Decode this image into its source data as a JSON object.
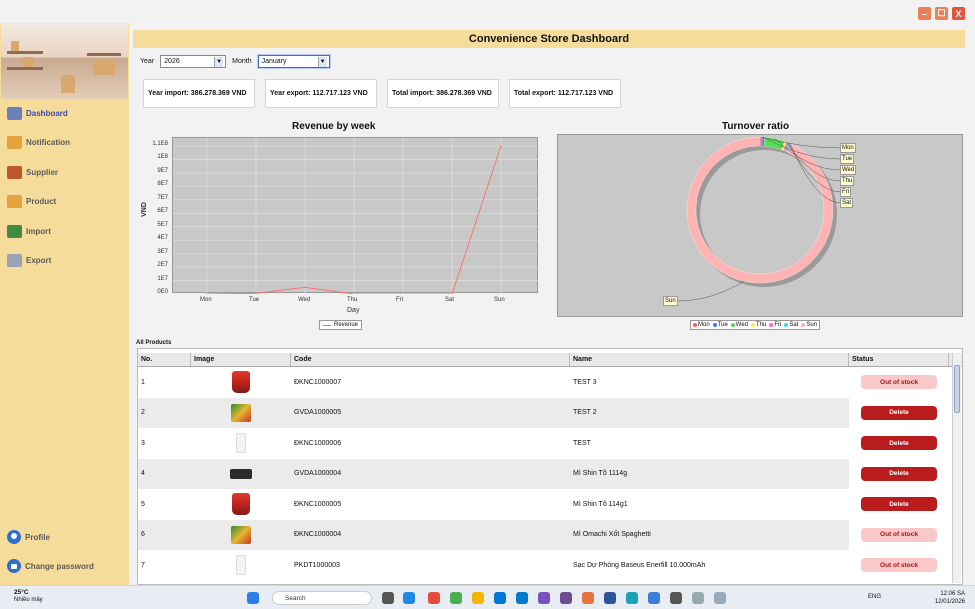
{
  "window": {
    "min_label": "–",
    "max_label": "☐",
    "close_label": "X"
  },
  "sidebar": {
    "items": [
      {
        "label": "Dashboard",
        "icon": "dashboard-icon",
        "color": "#6b7fb8"
      },
      {
        "label": "Notification",
        "icon": "bell-icon",
        "color": "#e6a23c"
      },
      {
        "label": "Supplier",
        "icon": "store-icon",
        "color": "#c0562f"
      },
      {
        "label": "Product",
        "icon": "box-icon",
        "color": "#e6a23c"
      },
      {
        "label": "Import",
        "icon": "import-icon",
        "color": "#3f8b3f"
      },
      {
        "label": "Export",
        "icon": "export-icon",
        "color": "#9aa3b5"
      }
    ],
    "profile": "Profile",
    "change_password": "Change password"
  },
  "header": {
    "title": "Convenience Store Dashboard"
  },
  "filters": {
    "year_label": "Year",
    "year_value": "2026",
    "month_label": "Month",
    "month_value": "January"
  },
  "stats": [
    "Year import: 386.278.369 VND",
    "Year export: 112.717.123 VND",
    "Total import: 386.278.369 VND",
    "Total export: 112.717.123 VND"
  ],
  "chart_data": [
    {
      "type": "line",
      "title": "Revenue by week",
      "xlabel": "Day",
      "ylabel": "VND",
      "categories": [
        "Mon",
        "Tue",
        "Wed",
        "Thu",
        "Fri",
        "Sat",
        "Sun"
      ],
      "series": [
        {
          "name": "Revenue",
          "values": [
            0,
            500000,
            5000000,
            0,
            0,
            0,
            110000000
          ],
          "color": "#ff6b6b"
        }
      ],
      "ylim": [
        0,
        110000000
      ],
      "yticks": [
        "0E0",
        "1E7",
        "2E7",
        "3E7",
        "4E7",
        "5E7",
        "6E7",
        "7E7",
        "8E7",
        "9E7",
        "1E8",
        "1,1E8"
      ],
      "legend": "bottom"
    },
    {
      "type": "pie",
      "title": "Turnover ratio",
      "labels": [
        "Mon",
        "Tue",
        "Wed",
        "Thu",
        "Fri",
        "Sat",
        "Sun"
      ],
      "values": [
        0.5,
        0.5,
        4.5,
        0.5,
        0.5,
        0.5,
        93
      ],
      "colors": [
        "#ff5a5a",
        "#4a6cff",
        "#55dd55",
        "#f2f244",
        "#ff66cc",
        "#44d9d9",
        "#ffb3b3"
      ],
      "legend": "bottom"
    }
  ],
  "products": {
    "section_label": "All Products",
    "headers": [
      "No.",
      "Image",
      "Code",
      "Name",
      "Status"
    ],
    "rows": [
      {
        "no": "1",
        "img": "cup",
        "code": "ĐKNC1000007",
        "name": "TEST 3",
        "status": "Out of stock",
        "kind": "oos"
      },
      {
        "no": "2",
        "img": "pack",
        "code": "GVDA1000005",
        "name": "TEST 2",
        "status": "Delete",
        "kind": "del"
      },
      {
        "no": "3",
        "img": "blank",
        "code": "ĐKNC1000006",
        "name": "TEST",
        "status": "Delete",
        "kind": "del"
      },
      {
        "no": "4",
        "img": "cable",
        "code": "GVDA1000004",
        "name": "Mì Shin Tô 1114g",
        "status": "Delete",
        "kind": "del"
      },
      {
        "no": "5",
        "img": "cup",
        "code": "ĐKNC1000005",
        "name": "Mì Shin Tô 114g1",
        "status": "Delete",
        "kind": "del"
      },
      {
        "no": "6",
        "img": "pack",
        "code": "ĐKNC1000004",
        "name": "Mì Omachi Xốt Spaghetti",
        "status": "Out of stock",
        "kind": "oos"
      },
      {
        "no": "7",
        "img": "blank",
        "code": "PKDT1000003",
        "name": "Sạc Dự Phòng Baseus Enerfill 10.000mAh",
        "status": "Out of stock",
        "kind": "oos"
      }
    ]
  },
  "taskbar": {
    "temp": "25°C",
    "weather": "Nhiều mây",
    "search": "Search",
    "lang": "ENG",
    "time": "12:06 SA",
    "date": "12/01/2026"
  }
}
